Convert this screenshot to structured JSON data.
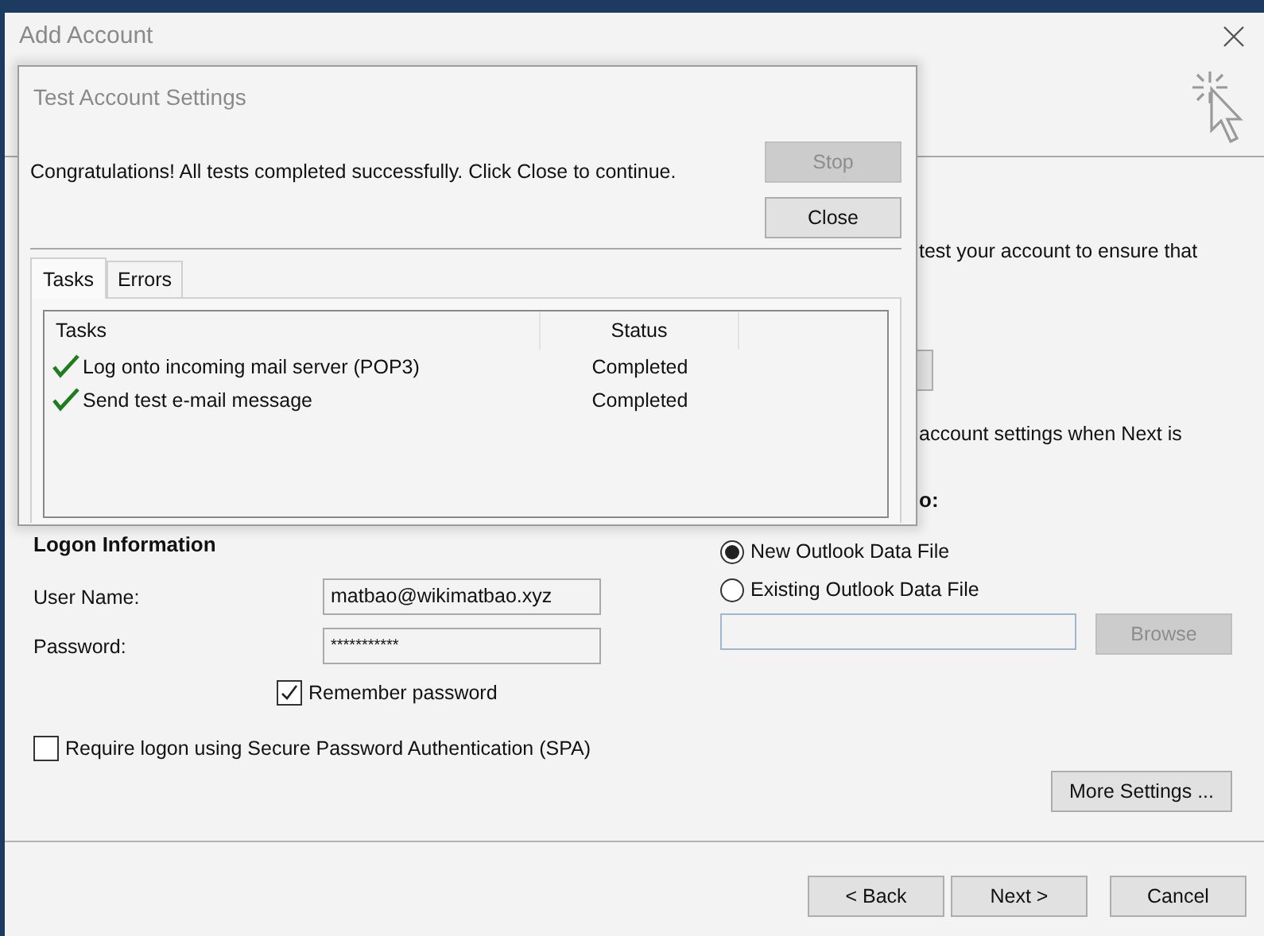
{
  "window": {
    "title": "Add Account"
  },
  "fragments": {
    "intro": "test your account to ensure that",
    "next_note": "account settings when Next is",
    "deliver_heading": "o:"
  },
  "logon": {
    "heading": "Logon Information",
    "fields": [
      {
        "label": "User Name:",
        "value": "matbao@wikimatbao.xyz"
      },
      {
        "label": "Password:",
        "value": "***********"
      }
    ],
    "remember": {
      "label": "Remember password",
      "checked": true
    },
    "spa": {
      "label": "Require logon using Secure Password Authentication (SPA)",
      "checked": false
    }
  },
  "deliver": {
    "options": [
      {
        "label": "New Outlook Data File",
        "selected": true
      },
      {
        "label": "Existing Outlook Data File",
        "selected": false
      }
    ],
    "browse": {
      "label": "Browse",
      "disabled": true
    }
  },
  "more_settings": {
    "label": "More Settings ..."
  },
  "footer_buttons": [
    {
      "label": "< Back"
    },
    {
      "label": "Next >"
    },
    {
      "label": "Cancel"
    }
  ],
  "dialog": {
    "title": "Test Account Settings",
    "message": "Congratulations! All tests completed successfully. Click Close to continue.",
    "buttons": [
      {
        "label": "Stop",
        "disabled": true
      },
      {
        "label": "Close",
        "disabled": false
      }
    ],
    "tabs": [
      {
        "label": "Tasks",
        "selected": true
      },
      {
        "label": "Errors",
        "selected": false
      }
    ],
    "columns": [
      "Tasks",
      "Status"
    ],
    "rows": [
      {
        "task": "Log onto incoming mail server (POP3)",
        "status": "Completed",
        "done": true
      },
      {
        "task": "Send test e-mail message",
        "status": "Completed",
        "done": true
      }
    ]
  }
}
